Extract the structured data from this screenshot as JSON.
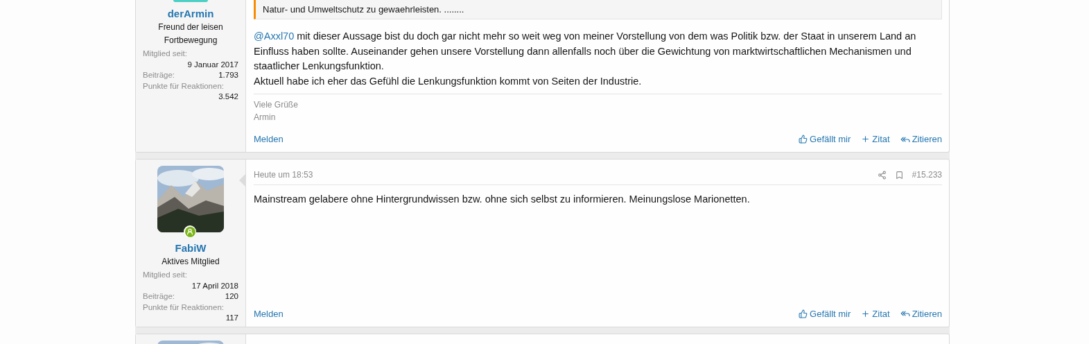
{
  "posts": [
    {
      "kind": "full",
      "user": {
        "name": "derArmin",
        "title": "Freund der leisen Fortbewegung",
        "avatar": {
          "kind": "cut"
        }
      },
      "stats": [
        {
          "label": "Mitglied seit:",
          "value": "9 Januar 2017"
        },
        {
          "label": "Beiträge:",
          "value": "1.793"
        },
        {
          "label": "Punkte für Reaktionen:",
          "value": "3.542"
        }
      ],
      "quote": "Natur- und Umweltschutz zu gewaehrleisten. ........",
      "body": [
        [
          {
            "kind": "mention",
            "text": "@Axxl70"
          },
          {
            "kind": "text",
            "text": " mit dieser Aussage bist du doch gar nicht mehr so weit weg von meiner Vorstellung von dem was Politik bzw. der Staat in unserem Land an Einfluss haben sollte. Auseinander gehen unsere Vorstellung dann allenfalls noch über die Gewichtung von marktwirtschaftlichen Mechanismen und staatlicher Lenkungsfunktion."
          }
        ],
        [
          {
            "kind": "text",
            "text": "Aktuell habe ich eher das Gefühl die Lenkungsfunktion kommt von Seiten der Industrie."
          }
        ]
      ],
      "signature": [
        "Viele Grüße",
        "Armin"
      ],
      "actions": {
        "report": "Melden",
        "like": "Gefällt mir",
        "quote": "Zitat",
        "reply": "Zitieren"
      }
    },
    {
      "kind": "full",
      "user": {
        "name": "FabiW",
        "title": "Aktives Mitglied",
        "online": true
      },
      "stats": [
        {
          "label": "Mitglied seit:",
          "value": "17 April 2018"
        },
        {
          "label": "Beiträge:",
          "value": "120"
        },
        {
          "label": "Punkte für Reaktionen:",
          "value": "117"
        }
      ],
      "date": "Heute um 18:53",
      "number": "#15.233",
      "body": [
        [
          {
            "kind": "text",
            "text": "Mainstream gelabere ohne Hintergrundwissen bzw. ohne sich selbst zu informieren. Meinungslose Marionetten."
          }
        ]
      ],
      "actions": {
        "report": "Melden",
        "like": "Gefällt mir",
        "quote": "Zitat",
        "reply": "Zitieren"
      }
    },
    {
      "kind": "partial"
    }
  ]
}
